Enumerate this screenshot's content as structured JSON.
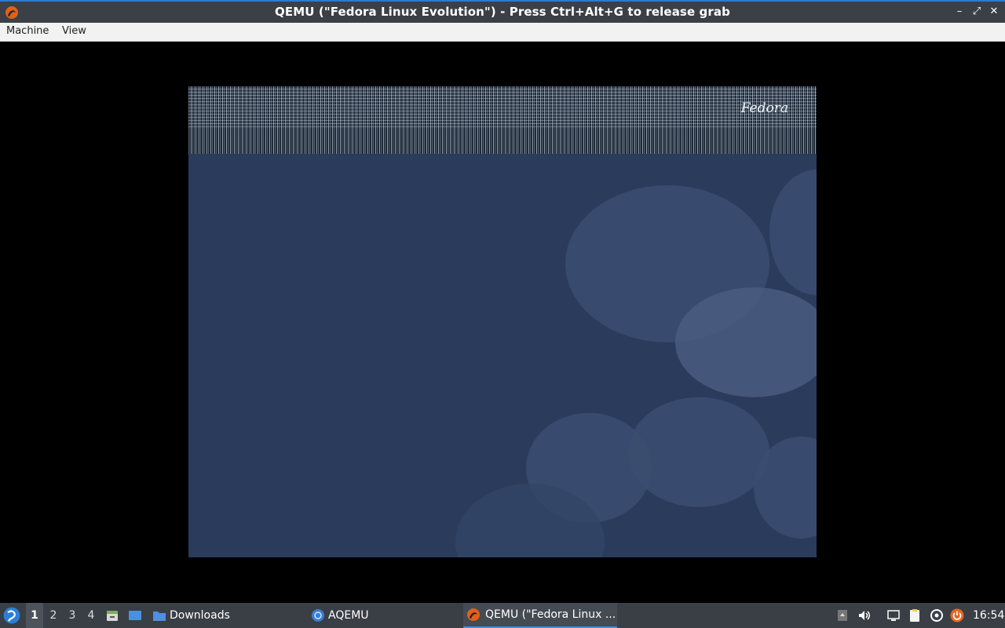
{
  "window": {
    "title": "QEMU (\"Fedora Linux Evolution\") - Press Ctrl+Alt+G to release grab",
    "controls": {
      "minimize": "–",
      "restore": "⤢",
      "close": "✕"
    }
  },
  "menubar": {
    "items": [
      "Machine",
      "View"
    ]
  },
  "guest": {
    "logo_text": "Fedora"
  },
  "taskbar": {
    "workspaces": [
      "1",
      "2",
      "3",
      "4"
    ],
    "active_workspace": "1",
    "tasks": [
      {
        "label": "Downloads",
        "icon": "folder-icon"
      },
      {
        "label": "AQEMU",
        "icon": "aqemu-icon"
      },
      {
        "label": "QEMU (\"Fedora Linux ...",
        "icon": "qemu-icon",
        "active": true
      }
    ],
    "clock": "16:54"
  },
  "colors": {
    "accent": "#3d8ee8",
    "titlebar": "#3b4046",
    "taskbar": "#3a3f45",
    "guest_background": "#2b3b5c"
  }
}
